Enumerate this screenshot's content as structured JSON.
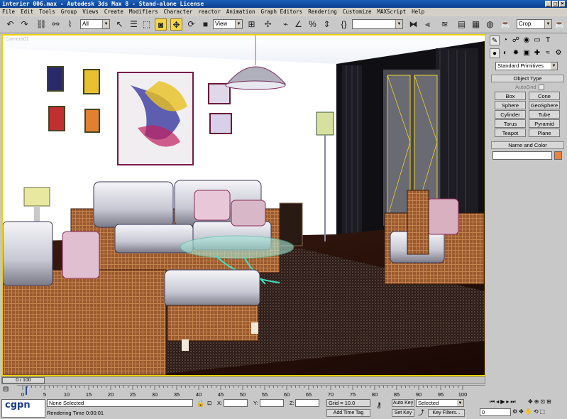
{
  "window": {
    "title": "interier 006.max - Autodesk 3ds Max 8 - Stand-alone License",
    "controls": [
      "_",
      "□",
      "×"
    ]
  },
  "menu": [
    "File",
    "Edit",
    "Tools",
    "Group",
    "Views",
    "Create",
    "Modifiers",
    "Character",
    "reactor",
    "Animation",
    "Graph Editors",
    "Rendering",
    "Customize",
    "MAXScript",
    "Help"
  ],
  "toolbar": {
    "selection_filter": "All",
    "reference_coord": "View",
    "named_selection": "",
    "render_type": "Crop"
  },
  "viewport": {
    "label": "Camera01",
    "frame_color": "#f0d000"
  },
  "command_panel": {
    "category_dropdown": "Standard Primitives",
    "object_type_title": "Object Type",
    "autogrid_label": "AutoGrid",
    "primitives": [
      "Box",
      "Cone",
      "Sphere",
      "GeoSphere",
      "Cylinder",
      "Tube",
      "Torus",
      "Pyramid",
      "Teapot",
      "Plane"
    ],
    "name_color_title": "Name and Color",
    "object_color": "#e8823c"
  },
  "timeline": {
    "slider_label": "0 / 100",
    "ticks": [
      "0",
      "5",
      "10",
      "15",
      "20",
      "25",
      "30",
      "35",
      "40",
      "45",
      "50",
      "55",
      "60",
      "65",
      "70",
      "75",
      "80",
      "85",
      "90",
      "95",
      "100"
    ]
  },
  "status": {
    "selection": "None Selected",
    "x_label": "X:",
    "y_label": "Y:",
    "z_label": "Z:",
    "x_value": "",
    "y_value": "",
    "z_value": "",
    "grid": "Grid = 10.0",
    "add_time_tag": "Add Time Tag",
    "render_time_prefix": "Rendering Time",
    "render_time": "0:00:01",
    "auto_key": "Auto Key",
    "set_key": "Set Key",
    "key_mode": "Selected",
    "key_filters": "Key Filters...",
    "current_frame": "0",
    "watermark": "cgpn"
  }
}
